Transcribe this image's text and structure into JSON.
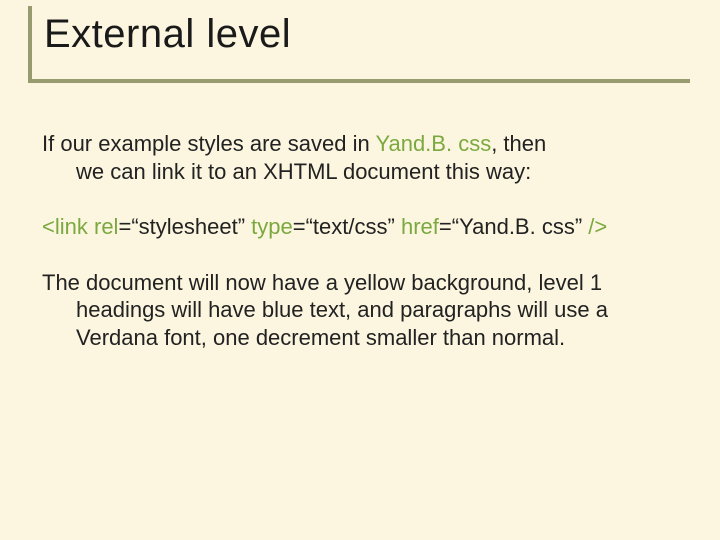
{
  "title": "External level",
  "para1": {
    "line1_pre": "If our example styles are saved in ",
    "filename": "Yand.B. css",
    "line1_post": ", then",
    "line2": "we can link it to an XHTML document this way:"
  },
  "code": {
    "open": "<",
    "tag": "link",
    "sp1": " ",
    "attr1": "rel",
    "eq1": "=",
    "val1": "“stylesheet”",
    "sp2": " ",
    "attr2": "type",
    "eq2": "=",
    "val2": "“text/css”",
    "sp3": " ",
    "attr3": "href",
    "eq3": "=",
    "val3": "“Yand.B. css”",
    "sp4": " ",
    "close": "/>"
  },
  "para3": {
    "line1": "The document will now have a yellow background, level 1",
    "line2": "headings will have blue text, and paragraphs will use a",
    "line3": "Verdana font, one decrement smaller than normal."
  }
}
